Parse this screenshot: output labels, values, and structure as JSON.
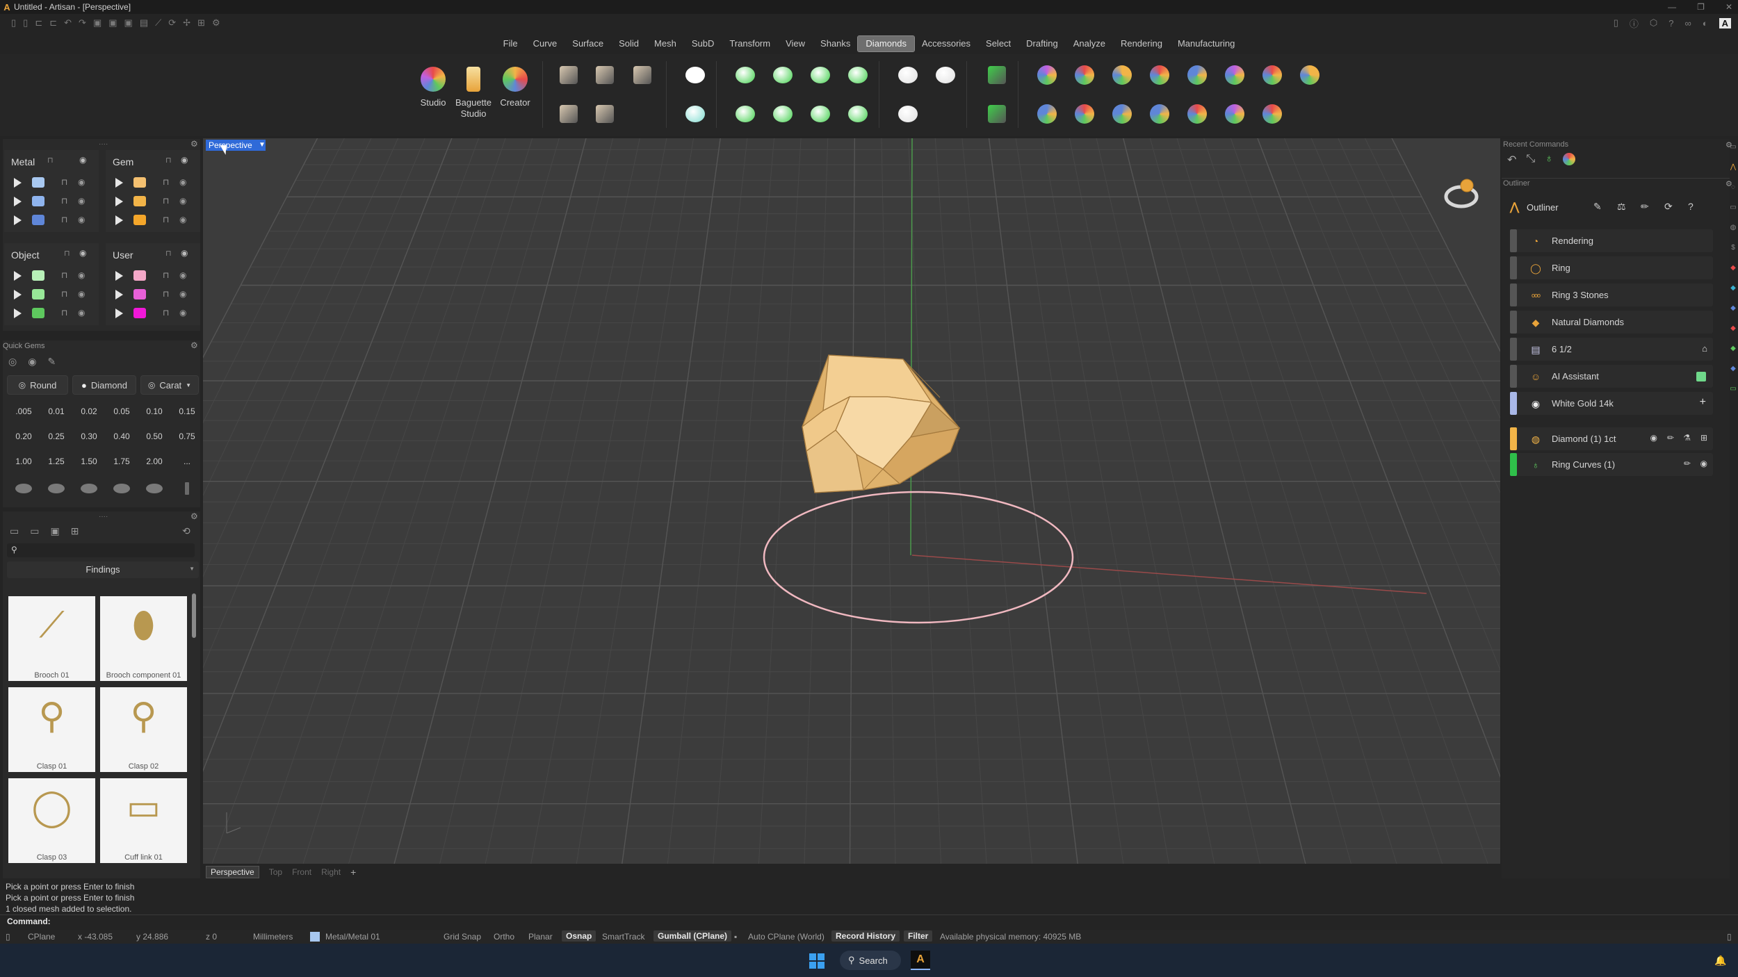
{
  "window": {
    "title": "Untitled - Artisan - [Perspective]"
  },
  "menu": [
    "File",
    "Curve",
    "Surface",
    "Solid",
    "Mesh",
    "SubD",
    "Transform",
    "View",
    "Shanks",
    "Diamonds",
    "Accessories",
    "Select",
    "Drafting",
    "Analyze",
    "Rendering",
    "Manufacturing"
  ],
  "menu_active": "Diamonds",
  "ribbon": {
    "studio": "Studio",
    "baguette_line1": "Baguette",
    "baguette_line2": "Studio",
    "creator": "Creator"
  },
  "layers": {
    "metal": {
      "title": "Metal",
      "colors": [
        "#a8c8f0",
        "#8fb4ee",
        "#5f86d8"
      ]
    },
    "gem": {
      "title": "Gem",
      "colors": [
        "#f4c070",
        "#f2b448",
        "#f4a62a"
      ]
    },
    "object": {
      "title": "Object",
      "colors": [
        "#b8f0b8",
        "#98e898",
        "#5ec85e"
      ]
    },
    "user": {
      "title": "User",
      "colors": [
        "#f4a8c8",
        "#e860d8",
        "#f018d8"
      ]
    }
  },
  "quick_gems": {
    "title": "Quick Gems",
    "shape": "Round",
    "type": "Diamond",
    "unit": "Carat",
    "carats": [
      ".005",
      "0.01",
      "0.02",
      "0.05",
      "0.10",
      "0.15",
      "0.20",
      "0.25",
      "0.30",
      "0.40",
      "0.50",
      "0.75",
      "1.00",
      "1.25",
      "1.50",
      "1.75",
      "2.00",
      "..."
    ]
  },
  "library": {
    "category": "Findings",
    "items": [
      "Brooch 01",
      "Brooch component 01",
      "Clasp 01",
      "Clasp 02",
      "Clasp 03",
      "Cuff link 01"
    ]
  },
  "viewport": {
    "active": "Perspective",
    "tabs": [
      "Perspective",
      "Top",
      "Front",
      "Right"
    ]
  },
  "recent_commands": {
    "title": "Recent Commands"
  },
  "outliner": {
    "title": "Outliner",
    "header_label": "Outliner",
    "rows": [
      {
        "label": "Rendering",
        "bar": "#555555",
        "icon": "rendering-icon"
      },
      {
        "label": "Ring",
        "bar": "#555555",
        "icon": "ring-icon"
      },
      {
        "label": "Ring 3 Stones",
        "bar": "#555555",
        "icon": "ring-3-stones-icon"
      },
      {
        "label": "Natural Diamonds",
        "bar": "#555555",
        "icon": "diamond-icon"
      },
      {
        "label": "6 1/2",
        "bar": "#555555",
        "icon": "us-flag-icon"
      },
      {
        "label": "AI Assistant",
        "bar": "#555555",
        "icon": "ai-assistant-icon"
      },
      {
        "label": "White Gold 14k",
        "bar": "#a9b8e8",
        "icon": "white-gold-icon"
      },
      {
        "label": "Diamond (1) 1ct",
        "bar": "#f2b448",
        "icon": "diamond-colors-icon"
      },
      {
        "label": "Ring Curves (1)",
        "bar": "#2fbf4a",
        "icon": "ring-curves-icon"
      }
    ]
  },
  "command_history": [
    "Pick a point or press Enter to finish",
    "Pick a point or press Enter to finish",
    "1 closed mesh added to selection."
  ],
  "command_label": "Command:",
  "status": {
    "cplane": "CPlane",
    "x": "x -43.085",
    "y": "y 24.886",
    "z": "z 0",
    "units": "Millimeters",
    "layer": "Metal/Metal 01",
    "grid_snap": "Grid Snap",
    "ortho": "Ortho",
    "planar": "Planar",
    "osnap": "Osnap",
    "smarttrack": "SmartTrack",
    "gumball": "Gumball (CPlane)",
    "auto_cplane": "Auto CPlane (World)",
    "record_history": "Record History",
    "filter": "Filter",
    "memory": "Available physical memory: 40925 MB"
  },
  "taskbar": {
    "search": "Search"
  }
}
